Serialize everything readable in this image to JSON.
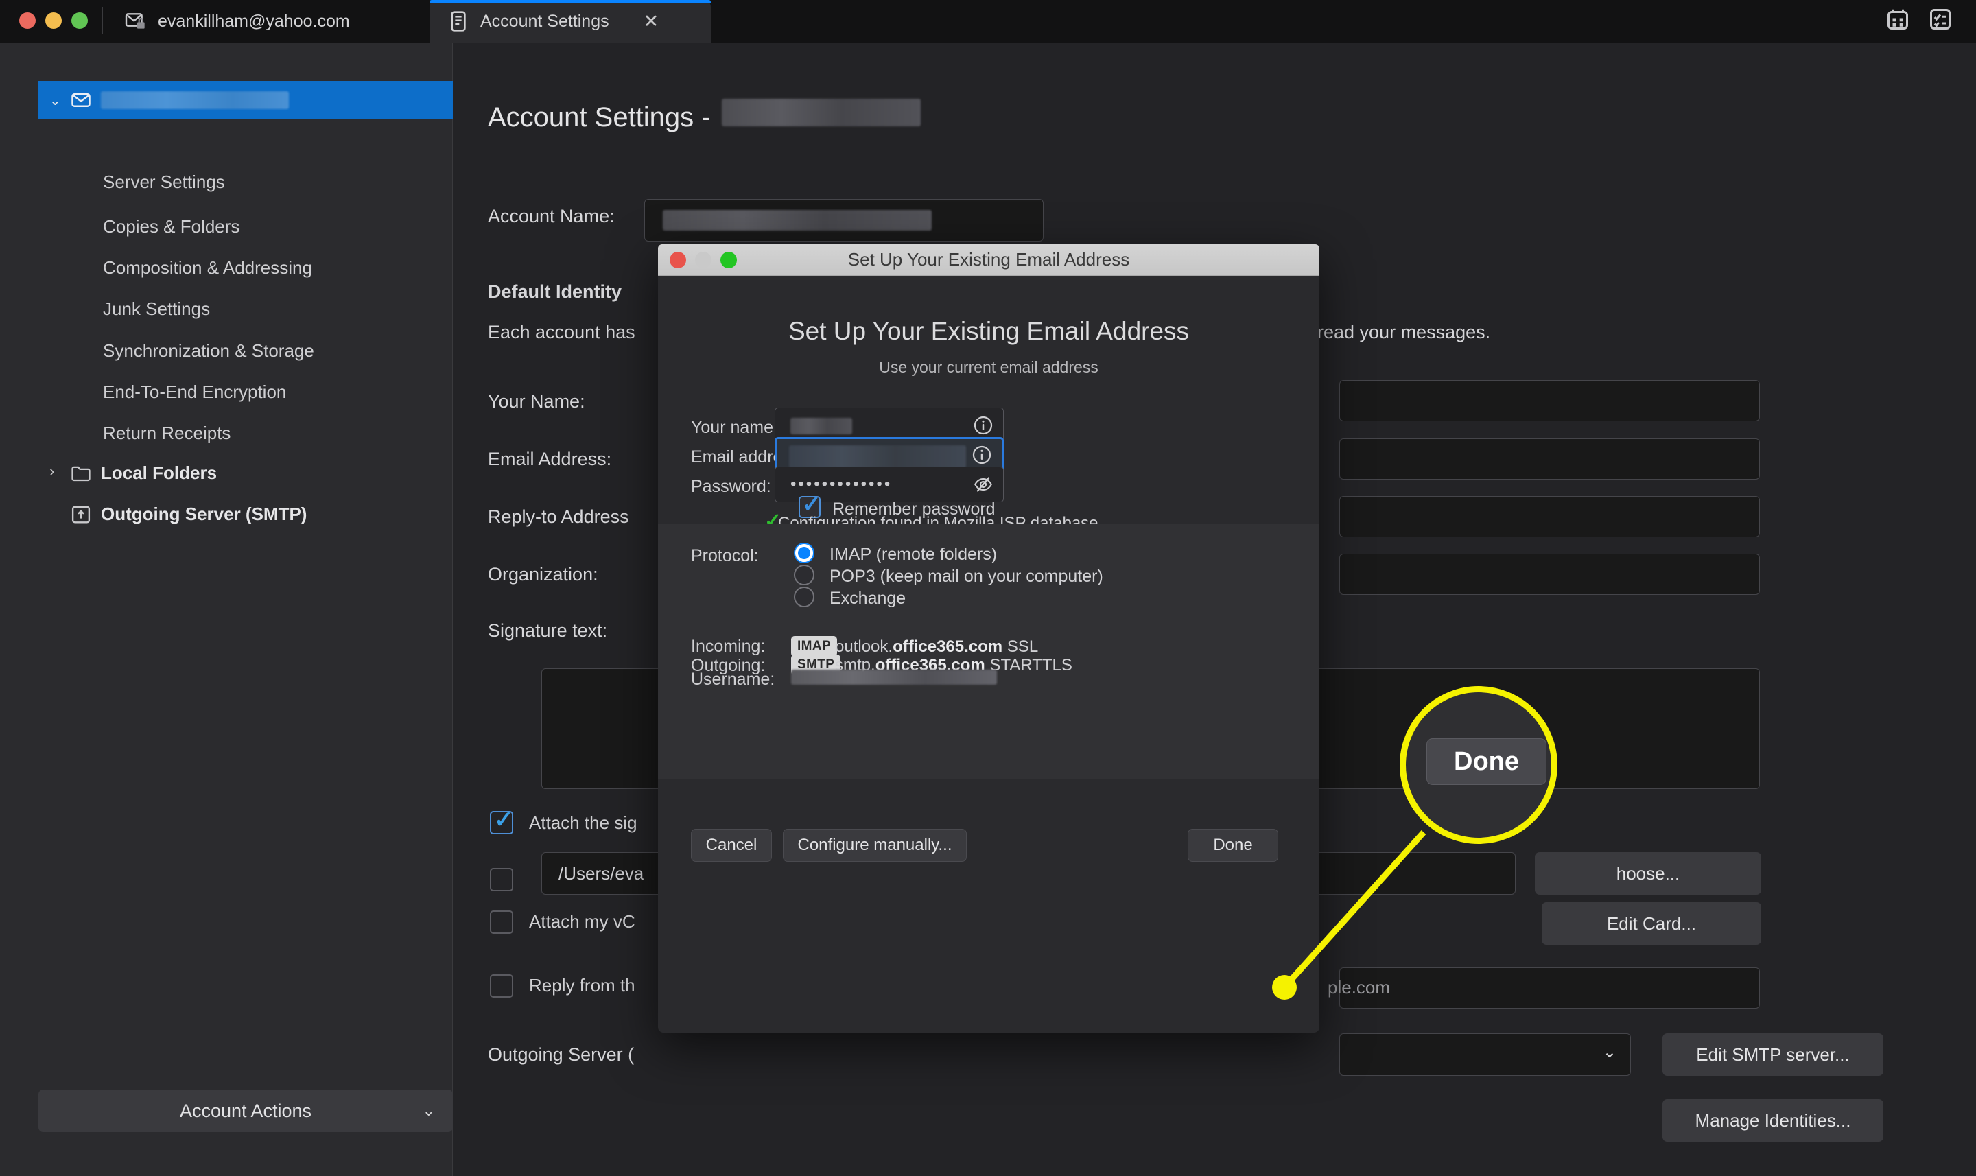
{
  "tabbar": {
    "tabs": [
      {
        "label": "evankillham@yahoo.com",
        "icon": "mail-lock-icon"
      },
      {
        "label": "Account Settings",
        "icon": "document-icon",
        "close": "✕"
      }
    ],
    "right_icons": [
      {
        "name": "calendar-icon"
      },
      {
        "name": "tasks-icon"
      }
    ]
  },
  "sidebar": {
    "account_row": {
      "icon": "mail-icon",
      "chevron": "⌄",
      "label_redacted": true
    },
    "items": [
      {
        "label": "Server Settings"
      },
      {
        "label": "Copies & Folders"
      },
      {
        "label": "Composition & Addressing"
      },
      {
        "label": "Junk Settings"
      },
      {
        "label": "Synchronization & Storage"
      },
      {
        "label": "End-To-End Encryption"
      },
      {
        "label": "Return Receipts"
      }
    ],
    "local_folders": {
      "label": "Local Folders",
      "arrow": "›",
      "icon": "folder-icon"
    },
    "outgoing_server": {
      "label": "Outgoing Server (SMTP)",
      "icon": "smtp-icon"
    },
    "account_actions": {
      "label": "Account Actions",
      "caret": "⌄"
    }
  },
  "main": {
    "page_title_prefix": "Account Settings -",
    "account_name_label": "Account Name:",
    "default_identity_heading": "Default Identity",
    "default_identity_desc_start": "Each account has",
    "default_identity_desc_end": "read your messages.",
    "labels": {
      "your_name": "Your Name:",
      "email_address": "Email Address:",
      "reply_to": "Reply-to Address",
      "organization": "Organization:",
      "signature_text": "Signature text:",
      "attach_signature": "Attach the sig",
      "signature_path": "/Users/eva",
      "attach_vcard": "Attach my vC",
      "reply_from": "Reply from th",
      "outgoing_server": "Outgoing Server (",
      "domain_fragment": "ple.com"
    },
    "buttons": {
      "choose": "hoose...",
      "edit_card": "Edit Card...",
      "edit_smtp": "Edit SMTP server...",
      "manage_identities": "Manage Identities..."
    },
    "checkboxes": {
      "attach_signature_checked": true,
      "attach_vcard_checked": false,
      "reply_from_checked": false
    }
  },
  "dialog": {
    "window_title": "Set Up Your Existing Email Address",
    "heading": "Set Up Your Existing Email Address",
    "subheading": "Use your current email address",
    "fields": [
      {
        "label": "Your name:",
        "value_redacted": true,
        "focused": false,
        "trailing_icon": "info-icon"
      },
      {
        "label": "Email address:",
        "value_redacted": true,
        "focused": true,
        "trailing_icon": "info-icon"
      },
      {
        "label": "Password:",
        "value": "•••••••••••••",
        "focused": false,
        "trailing_icon": "eye-off-icon"
      }
    ],
    "remember_password": {
      "label": "Remember password",
      "checked": true
    },
    "config_found": {
      "check": "✓",
      "label": "Configuration found in Mozilla ISP database"
    },
    "protocol": {
      "label": "Protocol:",
      "options": [
        {
          "label": "IMAP (remote folders)",
          "selected": true
        },
        {
          "label": "POP3 (keep mail on your computer)",
          "selected": false
        },
        {
          "label": "Exchange",
          "selected": false
        }
      ]
    },
    "servers": {
      "incoming_label": "Incoming:",
      "incoming_badge": "IMAP",
      "incoming_host_prefix": "outlook.",
      "incoming_host_bold": "office365.com",
      "incoming_security": "SSL",
      "outgoing_label": "Outgoing:",
      "outgoing_badge": "SMTP",
      "outgoing_host_prefix": "smtp.",
      "outgoing_host_bold": "office365.com",
      "outgoing_security": "STARTTLS",
      "username_label": "Username:",
      "username_redacted": true
    },
    "buttons": {
      "cancel": "Cancel",
      "configure_manually": "Configure manually...",
      "done": "Done"
    }
  },
  "callout": {
    "magnified_label": "Done",
    "highlight_color": "#f5f200"
  }
}
